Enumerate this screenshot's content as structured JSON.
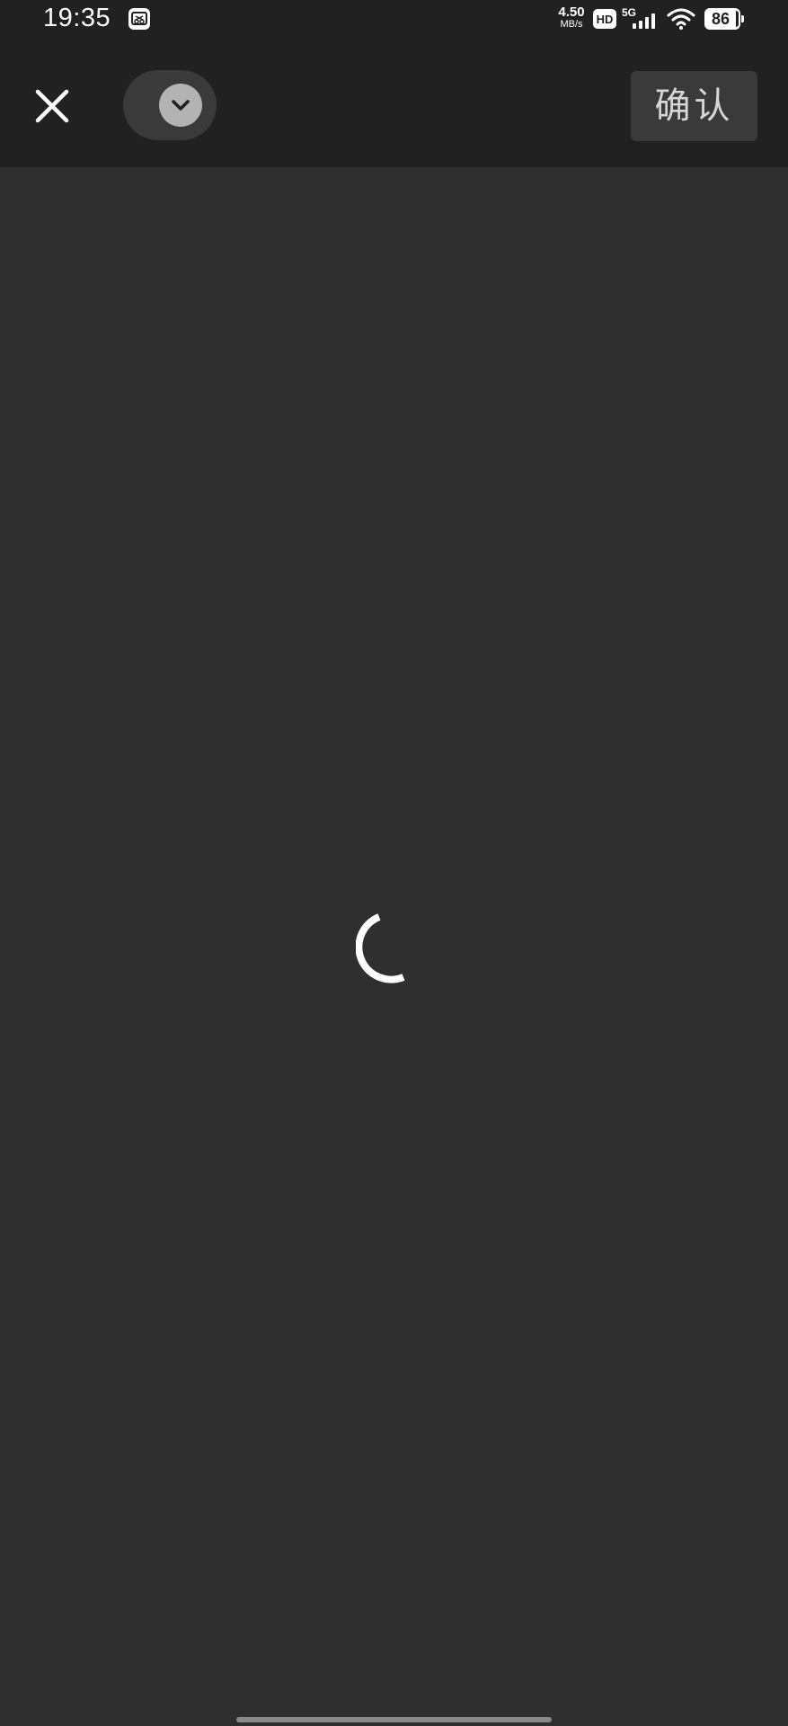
{
  "status_bar": {
    "time": "19:35",
    "notification_icon": "screen-capture-icon",
    "network_speed_value": "4.50",
    "network_speed_unit": "MB/s",
    "hd_label": "HD",
    "network_type": "5G",
    "battery_level": "86",
    "icons": [
      "hd-icon",
      "cellular-signal-icon",
      "wifi-icon",
      "battery-icon"
    ]
  },
  "toolbar": {
    "close_icon": "close-icon",
    "dropdown_icon": "chevron-down-icon",
    "confirm_label": "确认"
  },
  "content": {
    "state": "loading",
    "spinner_icon": "loading-spinner-icon"
  },
  "colors": {
    "background": "#2f2f2f",
    "toolbar": "#212121",
    "button": "#3a3a3a",
    "confirm_text": "#d6d6d6",
    "spinner": "#ffffff"
  }
}
